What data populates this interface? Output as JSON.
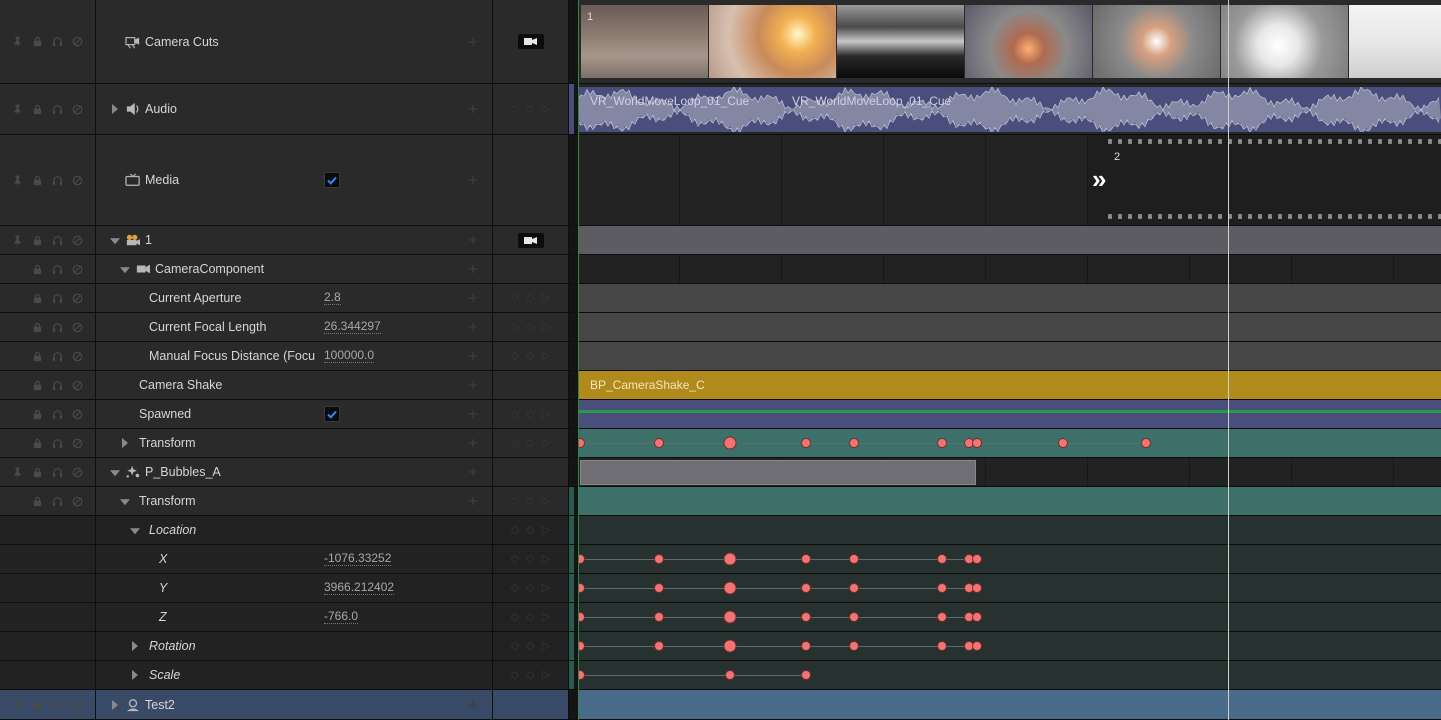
{
  "tracks": {
    "camera_cuts": {
      "label": "Camera Cuts",
      "shot_number": "1"
    },
    "audio": {
      "label": "Audio",
      "clip_label_1": "VR_WorldMoveLoop_01_Cue",
      "clip_label_2": "VR_WorldMoveLoop_01_Cue"
    },
    "media": {
      "label": "Media",
      "checked": true,
      "shot_number": "2",
      "chevron": "»"
    },
    "shot_1": {
      "label": "1"
    },
    "camera_component": {
      "label": "CameraComponent"
    },
    "current_aperture": {
      "label": "Current Aperture",
      "value": "2.8"
    },
    "current_focal_length": {
      "label": "Current Focal Length",
      "value": "26.344297"
    },
    "manual_focus_distance": {
      "label": "Manual Focus Distance (Focu",
      "value": "100000.0"
    },
    "camera_shake": {
      "label": "Camera Shake",
      "section_label": "BP_CameraShake_C"
    },
    "spawned": {
      "label": "Spawned",
      "checked": true
    },
    "transform": {
      "label": "Transform"
    },
    "p_bubbles": {
      "label": "P_Bubbles_A"
    },
    "bubbles_transform": {
      "label": "Transform"
    },
    "location": {
      "label": "Location"
    },
    "loc_x": {
      "label": "X",
      "value": "-1076.33252"
    },
    "loc_y": {
      "label": "Y",
      "value": "3966.212402"
    },
    "loc_z": {
      "label": "Z",
      "value": "-766.0"
    },
    "rotation": {
      "label": "Rotation"
    },
    "scale": {
      "label": "Scale"
    },
    "test2": {
      "label": "Test2"
    }
  },
  "colors": {
    "camera_shake_bar": "#b08a1a",
    "transform_bar": "#3e706a",
    "spawned_bar": "#4a4e7c",
    "keyframe": "#f07474",
    "selection": "#394a66"
  },
  "icons": {
    "row_controls": [
      "pin-icon",
      "lock-icon",
      "headphones-icon",
      "mute-icon"
    ],
    "key_nav": [
      "prev-key-icon",
      "add-key-icon",
      "next-key-icon"
    ]
  }
}
